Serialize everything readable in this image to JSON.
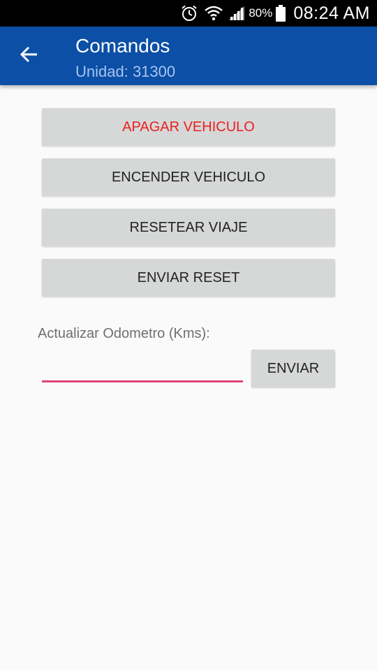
{
  "status_bar": {
    "battery_percent": "80%",
    "time": "08:24 AM",
    "icons": [
      "alarm-icon",
      "wifi-icon",
      "signal-icon",
      "battery-icon"
    ]
  },
  "app_bar": {
    "title": "Comandos",
    "subtitle": "Unidad: 31300",
    "back_icon": "arrow-back-icon",
    "color": "#0b4fa6"
  },
  "commands": {
    "apagar": "APAGAR VEHICULO",
    "encender": "ENCENDER VEHICULO",
    "resetear_viaje": "RESETEAR VIAJE",
    "enviar_reset": "ENVIAR RESET"
  },
  "odometer": {
    "label": "Actualizar Odometro (Kms):",
    "value": "",
    "placeholder": "",
    "send_label": "ENVIAR",
    "underline_color": "#e0437a"
  },
  "colors": {
    "danger_text": "#e8201f",
    "button_bg": "#d6d7d7"
  }
}
